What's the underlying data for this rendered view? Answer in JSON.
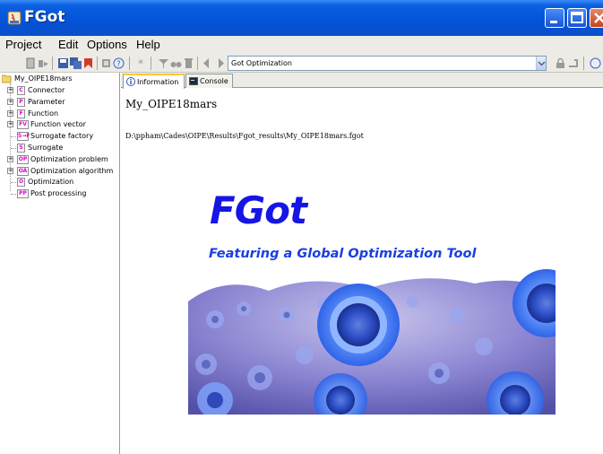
{
  "window": {
    "title": "FGot"
  },
  "menu": {
    "items": [
      "Project",
      "Edit",
      "Options",
      "Help"
    ]
  },
  "toolbar": {
    "combo_value": "Got Optimization"
  },
  "tree": {
    "root": "My_OIPE18mars",
    "items": [
      {
        "badge": "C",
        "label": "Connector",
        "expandable": true
      },
      {
        "badge": "P",
        "label": "Parameter",
        "expandable": true
      },
      {
        "badge": "F",
        "label": "Function",
        "expandable": true
      },
      {
        "badge": "FV",
        "label": "Function vector",
        "expandable": true
      },
      {
        "badge": "S→F",
        "label": "Surrogate factory",
        "expandable": false
      },
      {
        "badge": "S",
        "label": "Surrogate",
        "expandable": false
      },
      {
        "badge": "OP",
        "label": "Optimization problem",
        "expandable": true
      },
      {
        "badge": "OA",
        "label": "Optimization algorithm",
        "expandable": true
      },
      {
        "badge": "O",
        "label": "Optimization",
        "expandable": false
      },
      {
        "badge": "PP",
        "label": "Post processing",
        "expandable": false
      }
    ]
  },
  "tabs": [
    {
      "label": "Information",
      "active": true,
      "icon": "info-icon"
    },
    {
      "label": "Console",
      "active": false,
      "icon": "console-icon"
    }
  ],
  "document": {
    "title": "My_OIPE18mars",
    "path": "D:\\ppham\\Cades\\OIPE\\Results\\Fgot_results\\My_OIPE18mars.fgot"
  },
  "banner": {
    "logo_text": "FGot",
    "tagline": "Featuring a Global Optimization Tool"
  },
  "colors": {
    "titlebar": "#0453d9",
    "logo_blue": "#1515e6",
    "tree_badge": "#e000d0"
  }
}
